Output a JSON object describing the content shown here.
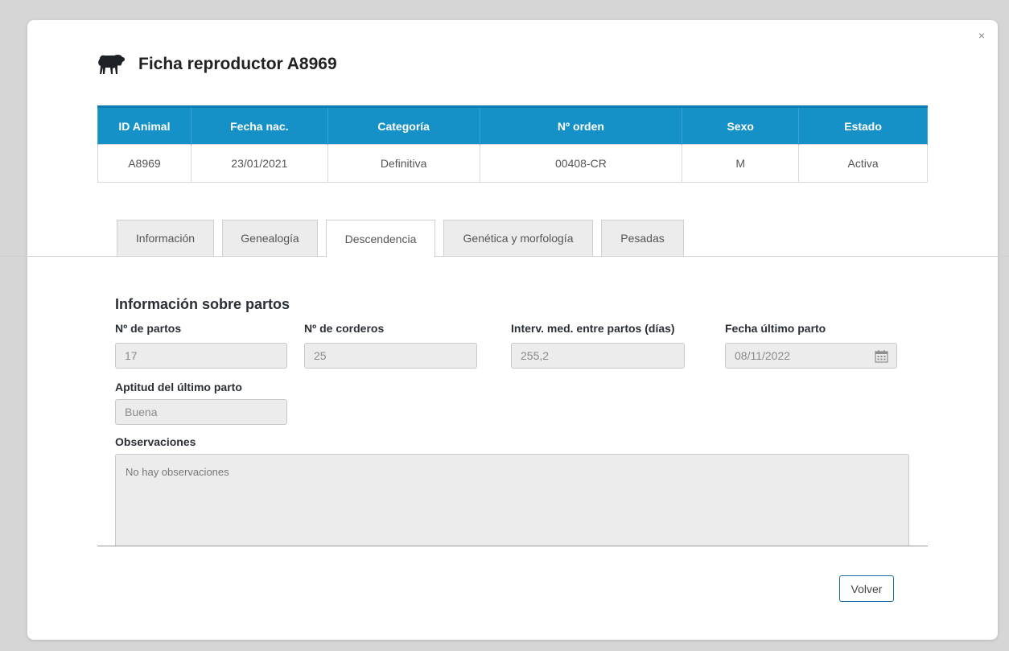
{
  "modal": {
    "close_label": "×",
    "title": "Ficha reproductor A8969",
    "icon": "sheep-icon"
  },
  "summary_table": {
    "headers": [
      "ID Animal",
      "Fecha nac.",
      "Categoría",
      "Nº orden",
      "Sexo",
      "Estado"
    ],
    "row": [
      "A8969",
      "23/01/2021",
      "Definitiva",
      "00408-CR",
      "M",
      "Activa"
    ]
  },
  "tabs": [
    {
      "label": "Información",
      "active": false
    },
    {
      "label": "Genealogía",
      "active": false
    },
    {
      "label": "Descendencia",
      "active": true
    },
    {
      "label": "Genética y morfología",
      "active": false
    },
    {
      "label": "Pesadas",
      "active": false
    }
  ],
  "partos": {
    "section_title": "Información sobre partos",
    "num_partos": {
      "label": "Nº de partos",
      "value": "17"
    },
    "num_corderos": {
      "label": "Nº de corderos",
      "value": "25"
    },
    "intervalo": {
      "label": "Interv. med. entre partos (días)",
      "value": "255,2"
    },
    "fecha_ultimo": {
      "label": "Fecha último parto",
      "value": "08/11/2022",
      "icon": "calendar-icon"
    },
    "aptitud": {
      "label": "Aptitud del último parto",
      "value": "Buena"
    },
    "observaciones": {
      "label": "Observaciones",
      "value": "No hay observaciones"
    }
  },
  "footer": {
    "volver_label": "Volver"
  },
  "colors": {
    "header_blue": "#1691c8",
    "button_border": "#1a6ea8"
  }
}
